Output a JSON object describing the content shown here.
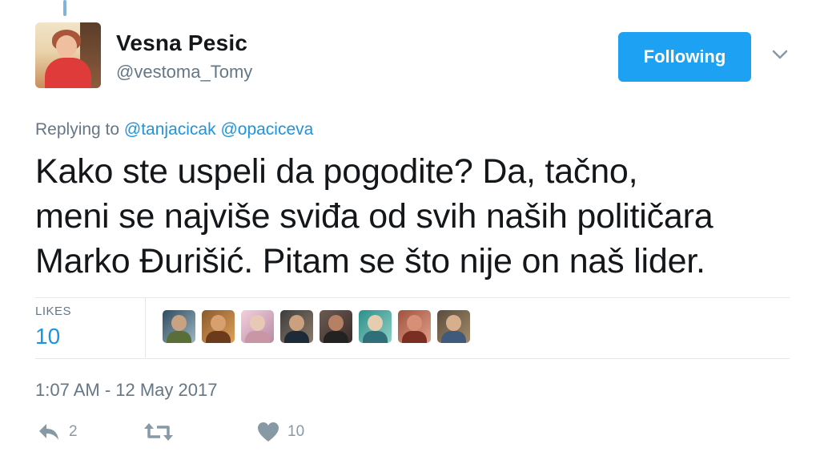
{
  "author": {
    "name": "Vesna Pesic",
    "handle": "@vestoma_Tomy"
  },
  "follow_button": {
    "label": "Following"
  },
  "reply_context": {
    "prefix": "Replying to",
    "mentions": [
      "@tanjacicak",
      "@opaciceva"
    ]
  },
  "tweet": {
    "lines": [
      "Kako ste uspeli da pogodite? Da, tačno,",
      "meni se najviše sviđa od svih naših političara",
      "Marko Đurišić. Pitam se što nije on naš lider."
    ]
  },
  "stats": {
    "likes_label": "LIKES",
    "likes_count": "10"
  },
  "likers_count_shown": 8,
  "timestamp": "1:07 AM - 12 May 2017",
  "actions": {
    "reply_count": "2",
    "retweet_count": "",
    "like_count": "10"
  },
  "colors": {
    "accent": "#1da1f2",
    "link": "#1b95e0",
    "muted": "#657786",
    "icon": "#8899a6",
    "divider": "#e1e8ed"
  },
  "icons": [
    "chevron-down-icon",
    "reply-icon",
    "retweet-icon",
    "heart-icon"
  ]
}
